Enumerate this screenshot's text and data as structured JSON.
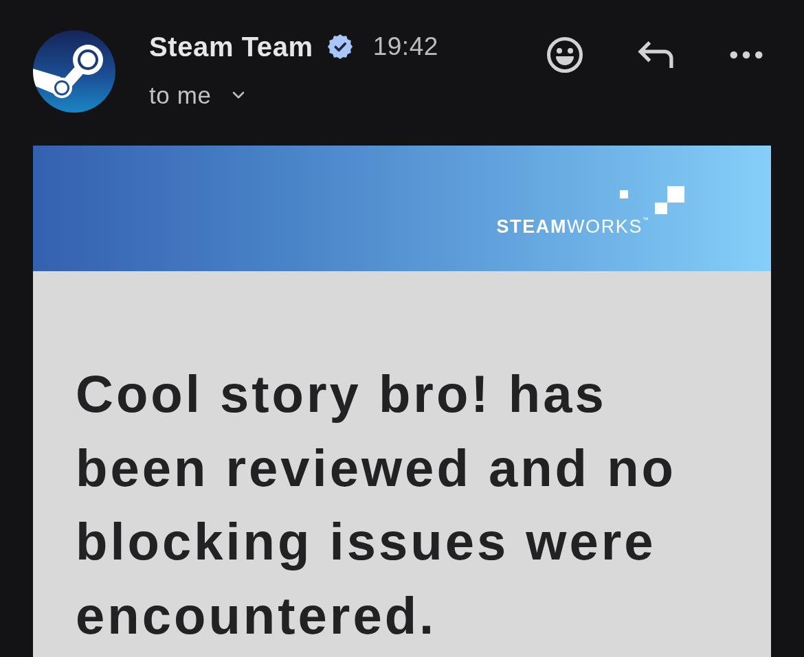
{
  "sender": {
    "name": "Steam Team",
    "verified": true,
    "time": "19:42",
    "recipient": "to me"
  },
  "banner": {
    "logo": "**STEAM**WORKS$^{™}$"
  },
  "message": {
    "heading": "Cool story bro! has been reviewed and no blocking issues were encountered."
  }
}
